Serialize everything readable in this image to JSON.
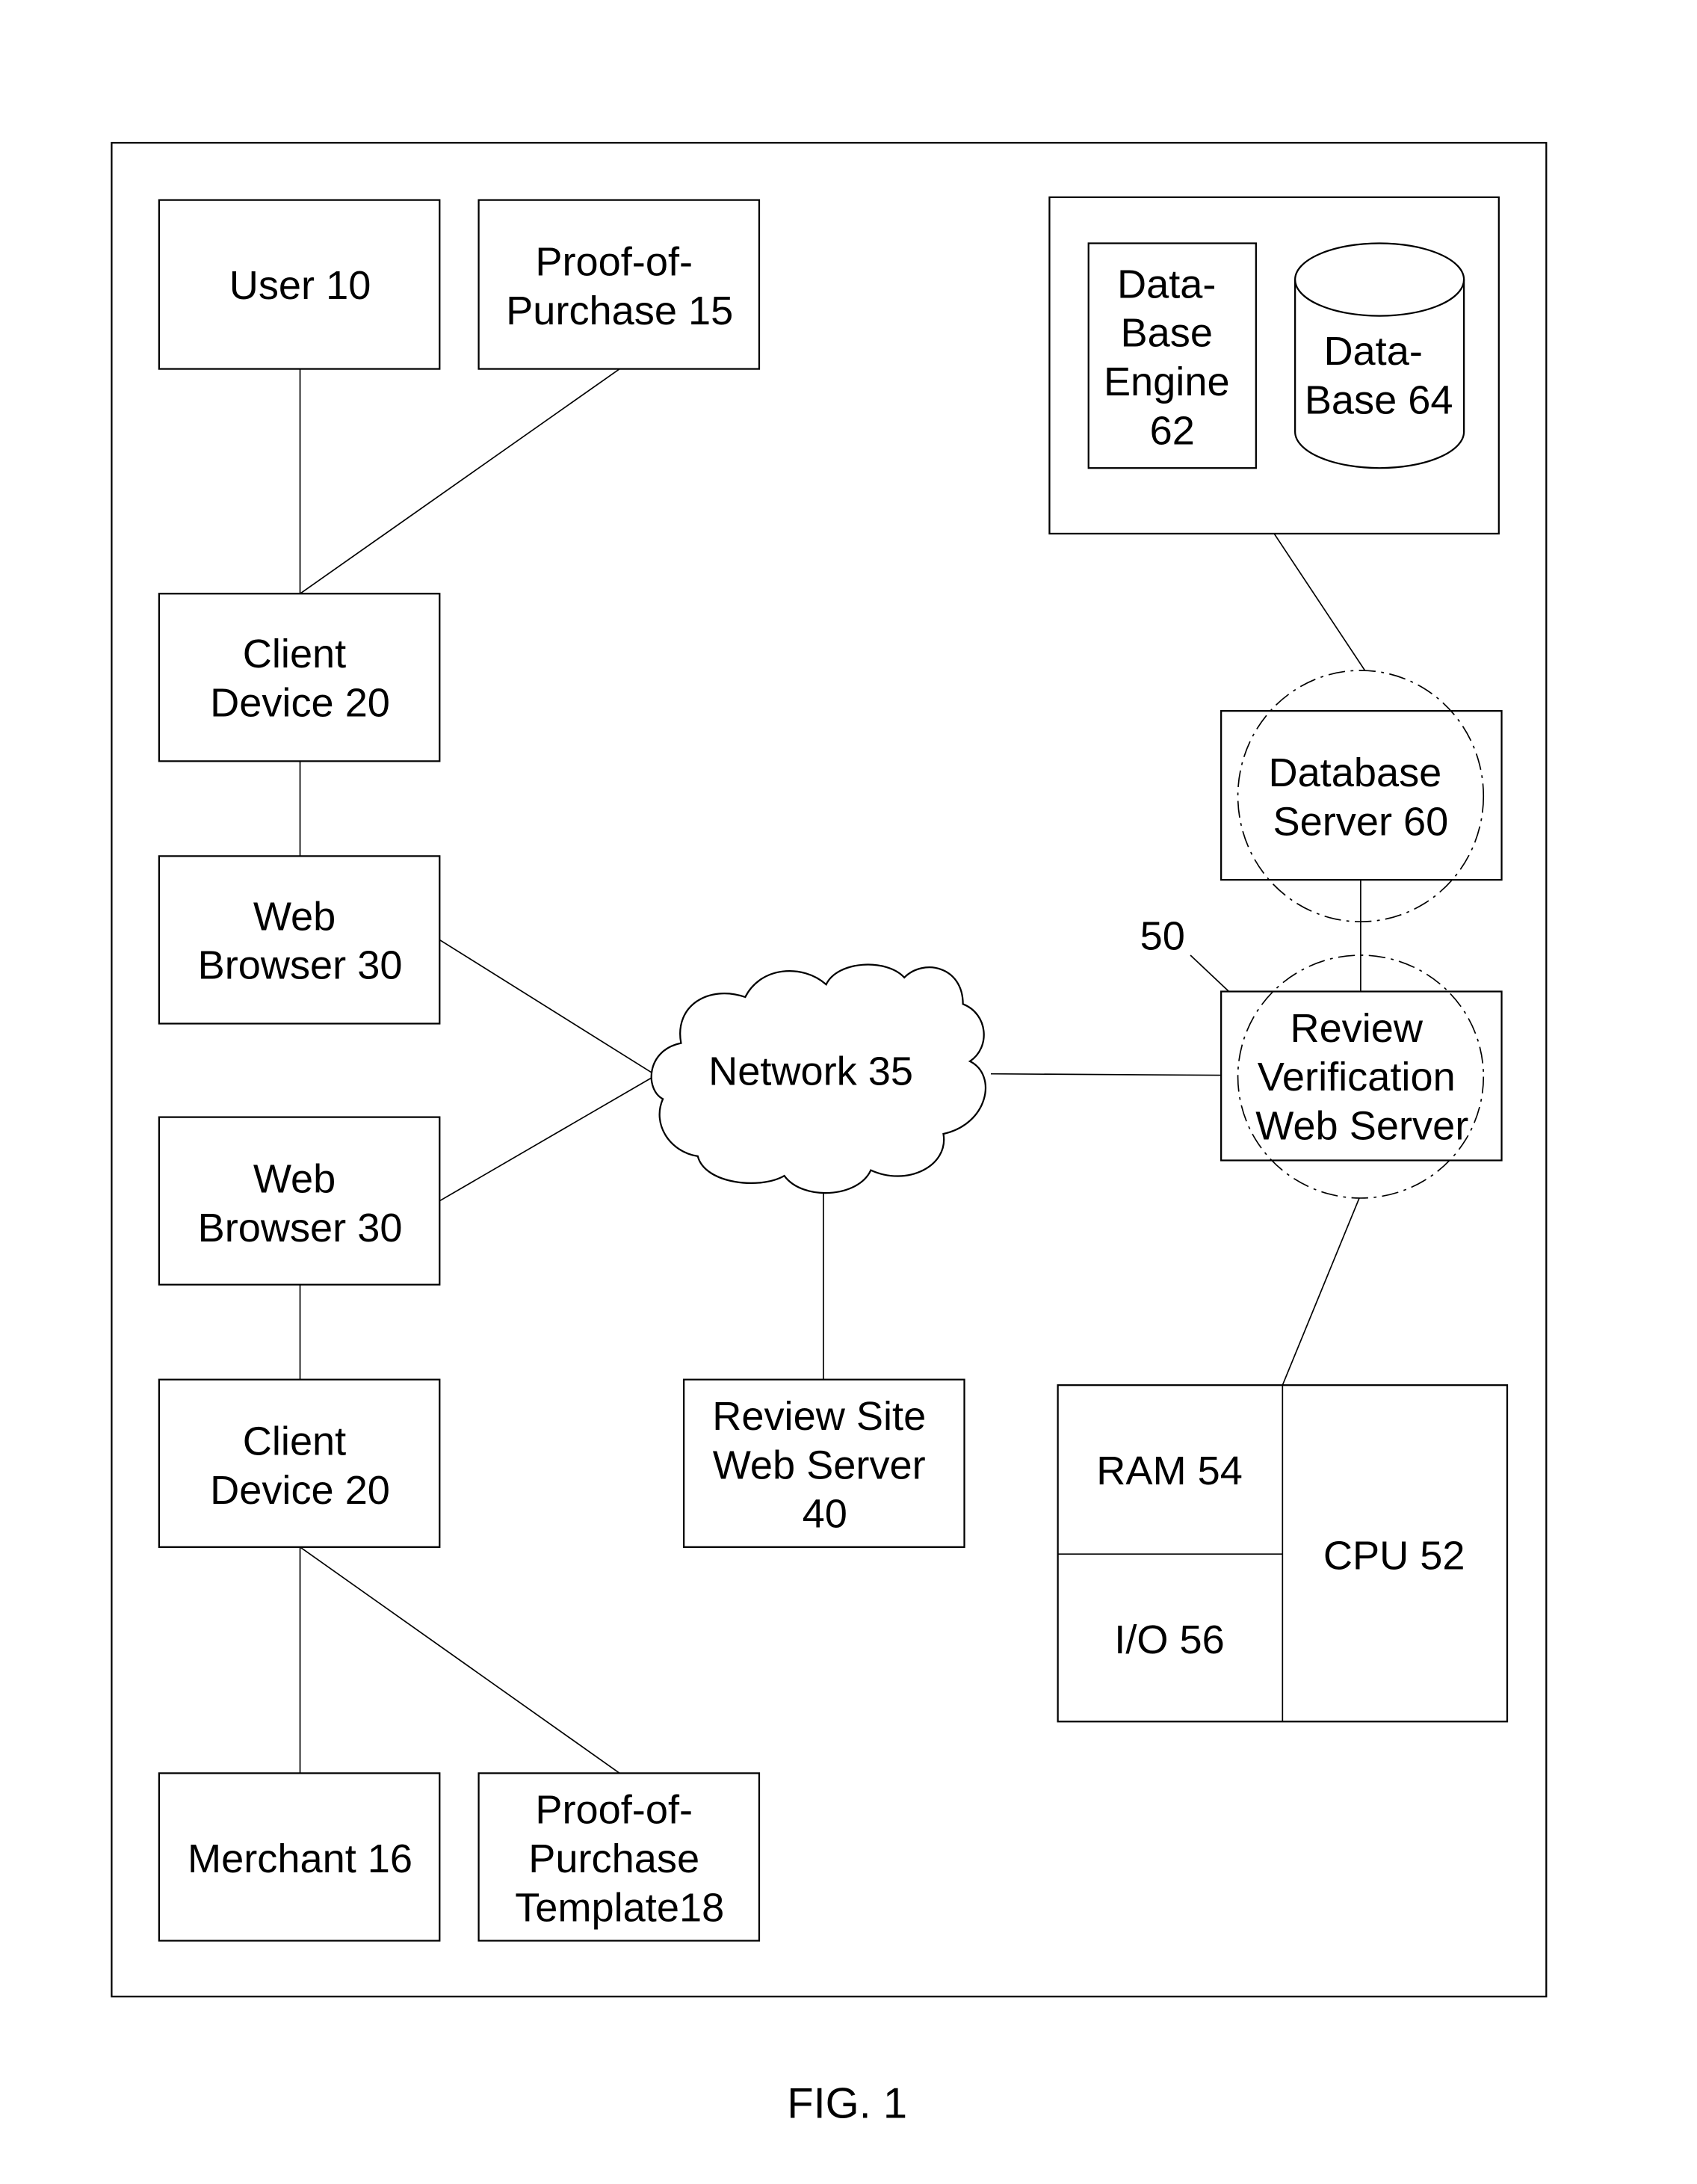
{
  "figure_caption": "FIG. 1",
  "nodes": {
    "user": {
      "lines": [
        "User 10"
      ]
    },
    "proof_purchase": {
      "lines": [
        "Proof-of-",
        "Purchase 15"
      ]
    },
    "client_device_top": {
      "lines": [
        "Client",
        "Device 20"
      ]
    },
    "web_browser_top": {
      "lines": [
        "Web",
        "Browser 30"
      ]
    },
    "web_browser_bottom": {
      "lines": [
        "Web",
        "Browser 30"
      ]
    },
    "client_device_bottom": {
      "lines": [
        "Client",
        "Device 20"
      ]
    },
    "merchant": {
      "lines": [
        "Merchant 16"
      ]
    },
    "proof_template": {
      "lines": [
        "Proof-of-",
        "Purchase",
        "Template18"
      ]
    },
    "network": {
      "lines": [
        "Network 35"
      ]
    },
    "review_site_server": {
      "lines": [
        "Review Site",
        "Web Server",
        "40"
      ]
    },
    "database_engine": {
      "lines": [
        "Data-",
        "Base",
        "Engine",
        "62"
      ]
    },
    "database": {
      "lines": [
        "Data-",
        "Base 64"
      ]
    },
    "database_server": {
      "lines": [
        "Database",
        "Server 60"
      ]
    },
    "review_verification_server": {
      "lines": [
        "Review",
        "Verification",
        "Web Server"
      ]
    },
    "ram": {
      "lines": [
        "RAM 54"
      ]
    },
    "io": {
      "lines": [
        "I/O 56"
      ]
    },
    "cpu": {
      "lines": [
        "CPU 52"
      ]
    }
  },
  "reference_label": "50",
  "connections": [
    [
      "user",
      "client_device_top"
    ],
    [
      "proof_purchase",
      "client_device_top"
    ],
    [
      "client_device_top",
      "web_browser_top"
    ],
    [
      "web_browser_top",
      "network"
    ],
    [
      "web_browser_bottom",
      "network"
    ],
    [
      "web_browser_bottom",
      "client_device_bottom"
    ],
    [
      "client_device_bottom",
      "merchant"
    ],
    [
      "client_device_bottom",
      "proof_template"
    ],
    [
      "network",
      "review_site_server"
    ],
    [
      "network",
      "review_verification_server"
    ],
    [
      "review_verification_server",
      "database_server"
    ],
    [
      "database_server",
      "database_container"
    ],
    [
      "review_verification_server",
      "cpu_block"
    ],
    [
      "database_engine",
      "database"
    ]
  ]
}
